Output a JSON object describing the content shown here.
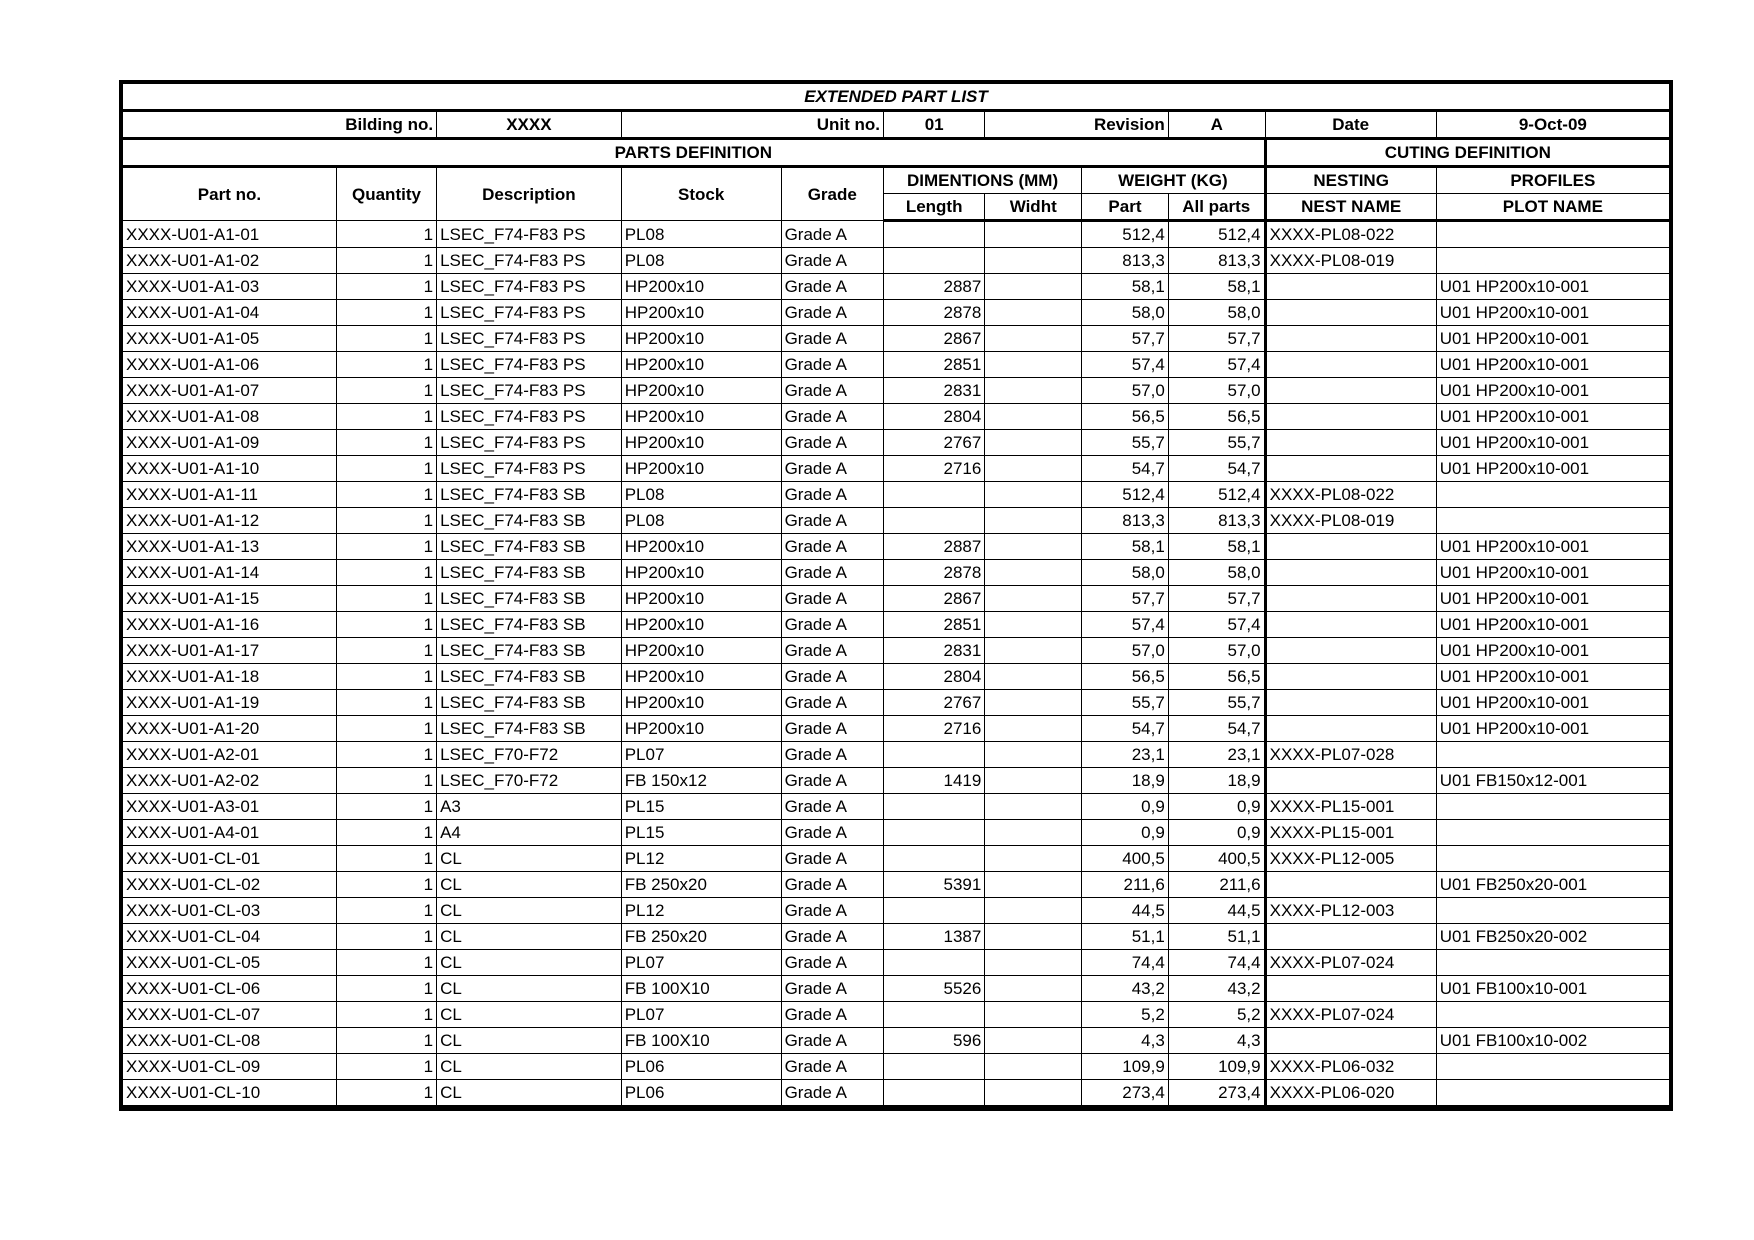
{
  "document": {
    "title": "EXTENDED PART LIST",
    "meta": {
      "building_label": "Bilding no.",
      "building_value": "XXXX",
      "unit_label": "Unit no.",
      "unit_value": "01",
      "revision_label": "Revision",
      "revision_value": "A",
      "date_label": "Date",
      "date_value": "9-Oct-09"
    },
    "bands": {
      "parts_definition": "PARTS DEFINITION",
      "cuting_definition": "CUTING DEFINITION"
    },
    "group_headers": {
      "dimentions": "DIMENTIONS (MM)",
      "weight": "WEIGHT (KG)",
      "nesting": "NESTING",
      "profiles": "PROFILES"
    },
    "columns": {
      "part_no": "Part no.",
      "quantity": "Quantity",
      "description": "Description",
      "stock": "Stock",
      "grade": "Grade",
      "length": "Length",
      "width": "Widht",
      "weight_part": "Part",
      "weight_all": "All parts",
      "nest_name": "NEST NAME",
      "plot_name": "PLOT NAME"
    }
  },
  "rows": [
    {
      "part_no": "XXXX-U01-A1-01",
      "quantity": "1",
      "description": "LSEC_F74-F83 PS",
      "stock": "PL08",
      "grade": "Grade A",
      "length": "",
      "width": "",
      "weight_part": "512,4",
      "weight_all": "512,4",
      "nest_name": "XXXX-PL08-022",
      "plot_name": ""
    },
    {
      "part_no": "XXXX-U01-A1-02",
      "quantity": "1",
      "description": "LSEC_F74-F83 PS",
      "stock": "PL08",
      "grade": "Grade A",
      "length": "",
      "width": "",
      "weight_part": "813,3",
      "weight_all": "813,3",
      "nest_name": "XXXX-PL08-019",
      "plot_name": ""
    },
    {
      "part_no": "XXXX-U01-A1-03",
      "quantity": "1",
      "description": "LSEC_F74-F83 PS",
      "stock": "HP200x10",
      "grade": "Grade A",
      "length": "2887",
      "width": "",
      "weight_part": "58,1",
      "weight_all": "58,1",
      "nest_name": "",
      "plot_name": "U01 HP200x10-001"
    },
    {
      "part_no": "XXXX-U01-A1-04",
      "quantity": "1",
      "description": "LSEC_F74-F83 PS",
      "stock": "HP200x10",
      "grade": "Grade A",
      "length": "2878",
      "width": "",
      "weight_part": "58,0",
      "weight_all": "58,0",
      "nest_name": "",
      "plot_name": "U01 HP200x10-001"
    },
    {
      "part_no": "XXXX-U01-A1-05",
      "quantity": "1",
      "description": "LSEC_F74-F83 PS",
      "stock": "HP200x10",
      "grade": "Grade A",
      "length": "2867",
      "width": "",
      "weight_part": "57,7",
      "weight_all": "57,7",
      "nest_name": "",
      "plot_name": "U01 HP200x10-001"
    },
    {
      "part_no": "XXXX-U01-A1-06",
      "quantity": "1",
      "description": "LSEC_F74-F83 PS",
      "stock": "HP200x10",
      "grade": "Grade A",
      "length": "2851",
      "width": "",
      "weight_part": "57,4",
      "weight_all": "57,4",
      "nest_name": "",
      "plot_name": "U01 HP200x10-001"
    },
    {
      "part_no": "XXXX-U01-A1-07",
      "quantity": "1",
      "description": "LSEC_F74-F83 PS",
      "stock": "HP200x10",
      "grade": "Grade A",
      "length": "2831",
      "width": "",
      "weight_part": "57,0",
      "weight_all": "57,0",
      "nest_name": "",
      "plot_name": "U01 HP200x10-001"
    },
    {
      "part_no": "XXXX-U01-A1-08",
      "quantity": "1",
      "description": "LSEC_F74-F83 PS",
      "stock": "HP200x10",
      "grade": "Grade A",
      "length": "2804",
      "width": "",
      "weight_part": "56,5",
      "weight_all": "56,5",
      "nest_name": "",
      "plot_name": "U01 HP200x10-001"
    },
    {
      "part_no": "XXXX-U01-A1-09",
      "quantity": "1",
      "description": "LSEC_F74-F83 PS",
      "stock": "HP200x10",
      "grade": "Grade A",
      "length": "2767",
      "width": "",
      "weight_part": "55,7",
      "weight_all": "55,7",
      "nest_name": "",
      "plot_name": "U01 HP200x10-001"
    },
    {
      "part_no": "XXXX-U01-A1-10",
      "quantity": "1",
      "description": "LSEC_F74-F83 PS",
      "stock": "HP200x10",
      "grade": "Grade A",
      "length": "2716",
      "width": "",
      "weight_part": "54,7",
      "weight_all": "54,7",
      "nest_name": "",
      "plot_name": "U01 HP200x10-001"
    },
    {
      "part_no": "XXXX-U01-A1-11",
      "quantity": "1",
      "description": "LSEC_F74-F83 SB",
      "stock": "PL08",
      "grade": "Grade A",
      "length": "",
      "width": "",
      "weight_part": "512,4",
      "weight_all": "512,4",
      "nest_name": "XXXX-PL08-022",
      "plot_name": ""
    },
    {
      "part_no": "XXXX-U01-A1-12",
      "quantity": "1",
      "description": "LSEC_F74-F83 SB",
      "stock": "PL08",
      "grade": "Grade A",
      "length": "",
      "width": "",
      "weight_part": "813,3",
      "weight_all": "813,3",
      "nest_name": "XXXX-PL08-019",
      "plot_name": ""
    },
    {
      "part_no": "XXXX-U01-A1-13",
      "quantity": "1",
      "description": "LSEC_F74-F83 SB",
      "stock": "HP200x10",
      "grade": "Grade A",
      "length": "2887",
      "width": "",
      "weight_part": "58,1",
      "weight_all": "58,1",
      "nest_name": "",
      "plot_name": "U01 HP200x10-001"
    },
    {
      "part_no": "XXXX-U01-A1-14",
      "quantity": "1",
      "description": "LSEC_F74-F83 SB",
      "stock": "HP200x10",
      "grade": "Grade A",
      "length": "2878",
      "width": "",
      "weight_part": "58,0",
      "weight_all": "58,0",
      "nest_name": "",
      "plot_name": "U01 HP200x10-001"
    },
    {
      "part_no": "XXXX-U01-A1-15",
      "quantity": "1",
      "description": "LSEC_F74-F83 SB",
      "stock": "HP200x10",
      "grade": "Grade A",
      "length": "2867",
      "width": "",
      "weight_part": "57,7",
      "weight_all": "57,7",
      "nest_name": "",
      "plot_name": "U01 HP200x10-001"
    },
    {
      "part_no": "XXXX-U01-A1-16",
      "quantity": "1",
      "description": "LSEC_F74-F83 SB",
      "stock": "HP200x10",
      "grade": "Grade A",
      "length": "2851",
      "width": "",
      "weight_part": "57,4",
      "weight_all": "57,4",
      "nest_name": "",
      "plot_name": "U01 HP200x10-001"
    },
    {
      "part_no": "XXXX-U01-A1-17",
      "quantity": "1",
      "description": "LSEC_F74-F83 SB",
      "stock": "HP200x10",
      "grade": "Grade A",
      "length": "2831",
      "width": "",
      "weight_part": "57,0",
      "weight_all": "57,0",
      "nest_name": "",
      "plot_name": "U01 HP200x10-001"
    },
    {
      "part_no": "XXXX-U01-A1-18",
      "quantity": "1",
      "description": "LSEC_F74-F83 SB",
      "stock": "HP200x10",
      "grade": "Grade A",
      "length": "2804",
      "width": "",
      "weight_part": "56,5",
      "weight_all": "56,5",
      "nest_name": "",
      "plot_name": "U01 HP200x10-001"
    },
    {
      "part_no": "XXXX-U01-A1-19",
      "quantity": "1",
      "description": "LSEC_F74-F83 SB",
      "stock": "HP200x10",
      "grade": "Grade A",
      "length": "2767",
      "width": "",
      "weight_part": "55,7",
      "weight_all": "55,7",
      "nest_name": "",
      "plot_name": "U01 HP200x10-001"
    },
    {
      "part_no": "XXXX-U01-A1-20",
      "quantity": "1",
      "description": "LSEC_F74-F83 SB",
      "stock": "HP200x10",
      "grade": "Grade A",
      "length": "2716",
      "width": "",
      "weight_part": "54,7",
      "weight_all": "54,7",
      "nest_name": "",
      "plot_name": "U01 HP200x10-001"
    },
    {
      "part_no": "XXXX-U01-A2-01",
      "quantity": "1",
      "description": "LSEC_F70-F72",
      "stock": "PL07",
      "grade": "Grade A",
      "length": "",
      "width": "",
      "weight_part": "23,1",
      "weight_all": "23,1",
      "nest_name": "XXXX-PL07-028",
      "plot_name": ""
    },
    {
      "part_no": "XXXX-U01-A2-02",
      "quantity": "1",
      "description": "LSEC_F70-F72",
      "stock": "FB 150x12",
      "grade": "Grade A",
      "length": "1419",
      "width": "",
      "weight_part": "18,9",
      "weight_all": "18,9",
      "nest_name": "",
      "plot_name": "U01 FB150x12-001"
    },
    {
      "part_no": "XXXX-U01-A3-01",
      "quantity": "1",
      "description": "A3",
      "stock": "PL15",
      "grade": "Grade A",
      "length": "",
      "width": "",
      "weight_part": "0,9",
      "weight_all": "0,9",
      "nest_name": "XXXX-PL15-001",
      "plot_name": ""
    },
    {
      "part_no": "XXXX-U01-A4-01",
      "quantity": "1",
      "description": "A4",
      "stock": "PL15",
      "grade": "Grade A",
      "length": "",
      "width": "",
      "weight_part": "0,9",
      "weight_all": "0,9",
      "nest_name": "XXXX-PL15-001",
      "plot_name": ""
    },
    {
      "part_no": "XXXX-U01-CL-01",
      "quantity": "1",
      "description": "CL",
      "stock": "PL12",
      "grade": "Grade A",
      "length": "",
      "width": "",
      "weight_part": "400,5",
      "weight_all": "400,5",
      "nest_name": "XXXX-PL12-005",
      "plot_name": ""
    },
    {
      "part_no": "XXXX-U01-CL-02",
      "quantity": "1",
      "description": "CL",
      "stock": "FB 250x20",
      "grade": "Grade A",
      "length": "5391",
      "width": "",
      "weight_part": "211,6",
      "weight_all": "211,6",
      "nest_name": "",
      "plot_name": "U01 FB250x20-001"
    },
    {
      "part_no": "XXXX-U01-CL-03",
      "quantity": "1",
      "description": "CL",
      "stock": "PL12",
      "grade": "Grade A",
      "length": "",
      "width": "",
      "weight_part": "44,5",
      "weight_all": "44,5",
      "nest_name": "XXXX-PL12-003",
      "plot_name": ""
    },
    {
      "part_no": "XXXX-U01-CL-04",
      "quantity": "1",
      "description": "CL",
      "stock": "FB 250x20",
      "grade": "Grade A",
      "length": "1387",
      "width": "",
      "weight_part": "51,1",
      "weight_all": "51,1",
      "nest_name": "",
      "plot_name": "U01 FB250x20-002"
    },
    {
      "part_no": "XXXX-U01-CL-05",
      "quantity": "1",
      "description": "CL",
      "stock": "PL07",
      "grade": "Grade A",
      "length": "",
      "width": "",
      "weight_part": "74,4",
      "weight_all": "74,4",
      "nest_name": "XXXX-PL07-024",
      "plot_name": ""
    },
    {
      "part_no": "XXXX-U01-CL-06",
      "quantity": "1",
      "description": "CL",
      "stock": "FB 100X10",
      "grade": "Grade A",
      "length": "5526",
      "width": "",
      "weight_part": "43,2",
      "weight_all": "43,2",
      "nest_name": "",
      "plot_name": "U01 FB100x10-001"
    },
    {
      "part_no": "XXXX-U01-CL-07",
      "quantity": "1",
      "description": "CL",
      "stock": "PL07",
      "grade": "Grade A",
      "length": "",
      "width": "",
      "weight_part": "5,2",
      "weight_all": "5,2",
      "nest_name": "XXXX-PL07-024",
      "plot_name": ""
    },
    {
      "part_no": "XXXX-U01-CL-08",
      "quantity": "1",
      "description": "CL",
      "stock": "FB 100X10",
      "grade": "Grade A",
      "length": "596",
      "width": "",
      "weight_part": "4,3",
      "weight_all": "4,3",
      "nest_name": "",
      "plot_name": "U01 FB100x10-002"
    },
    {
      "part_no": "XXXX-U01-CL-09",
      "quantity": "1",
      "description": "CL",
      "stock": "PL06",
      "grade": "Grade A",
      "length": "",
      "width": "",
      "weight_part": "109,9",
      "weight_all": "109,9",
      "nest_name": "XXXX-PL06-032",
      "plot_name": ""
    },
    {
      "part_no": "XXXX-U01-CL-10",
      "quantity": "1",
      "description": "CL",
      "stock": "PL06",
      "grade": "Grade A",
      "length": "",
      "width": "",
      "weight_part": "273,4",
      "weight_all": "273,4",
      "nest_name": "XXXX-PL06-020",
      "plot_name": ""
    }
  ]
}
